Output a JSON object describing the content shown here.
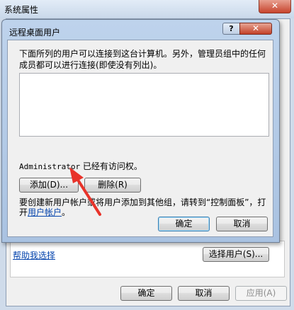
{
  "background_window": {
    "title": "系统属性",
    "close_glyph": "✕",
    "help_link": "帮助我选择",
    "select_users_label": "选择用户(S)...",
    "ok_label": "确定",
    "cancel_label": "取消",
    "apply_label": "应用(A)"
  },
  "dialog": {
    "title": "远程桌面用户",
    "help_glyph": "?",
    "close_glyph": "✕",
    "intro_text": "下面所列的用户可以连接到这台计算机。另外，管理员组中的任何成员都可以进行连接(即使没有列出)。",
    "access_user": "Administrator",
    "access_suffix": " 已经有访问权。",
    "add_label": "添加(D)...",
    "remove_label": "删除(R)",
    "note_prefix": "要创建新用户帐户或将用户添加到其他组，请转到“控制面板”，打开",
    "note_link": "用户帐户",
    "note_suffix": "。",
    "ok_label": "确定",
    "cancel_label": "取消"
  },
  "colors": {
    "annotation_arrow": "#e8332a",
    "link": "#0645ad"
  }
}
